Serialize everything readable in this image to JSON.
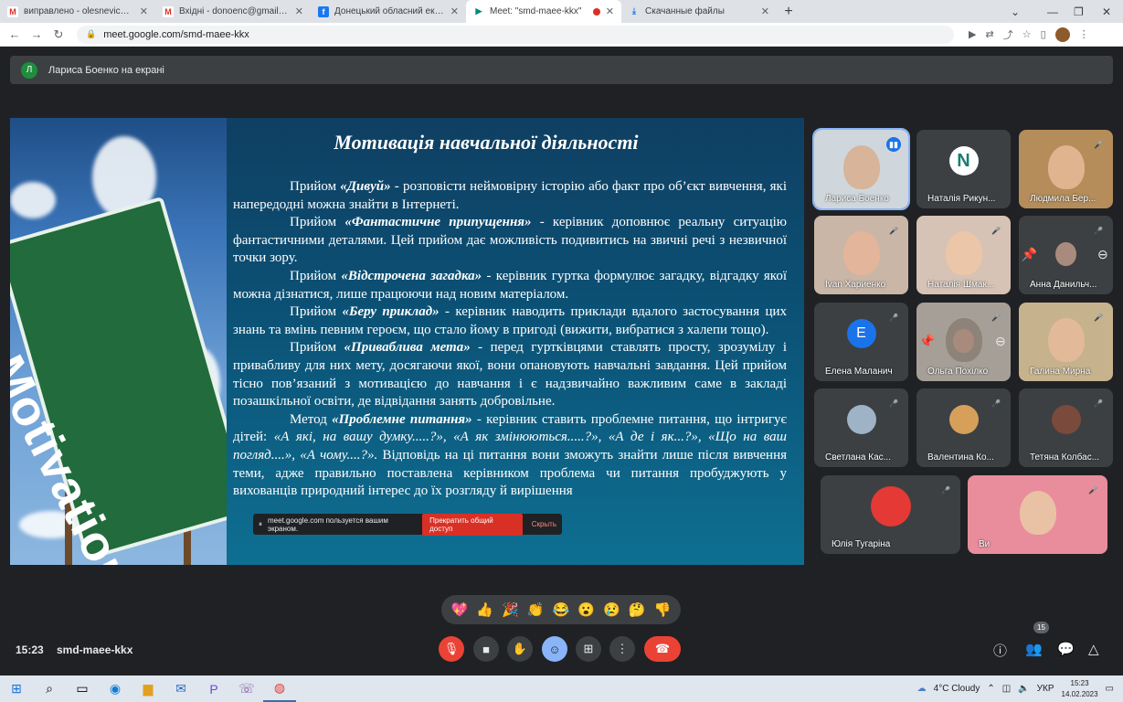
{
  "browser": {
    "tabs": [
      {
        "label": "виправлено - olesnevich88a@g",
        "icon": "gmail-icon"
      },
      {
        "label": "Вхідні - donoenc@gmail.com - G",
        "icon": "gmail-icon"
      },
      {
        "label": "Донецький обласний еколого-",
        "icon": "facebook-icon"
      },
      {
        "label": "Meet: \"smd-maee-kkx\"",
        "icon": "meet-icon",
        "active": true
      },
      {
        "label": "Скачанные файлы",
        "icon": "download-icon"
      }
    ],
    "url": "meet.google.com/smd-maee-kkx"
  },
  "meet": {
    "presenting_banner": {
      "initial": "Л",
      "text": "Лариса Боенко на екрані"
    },
    "slide": {
      "title": "Мотивація навчальної діяльності",
      "sign_text": "Motivation",
      "paragraphs": [
        {
          "lead": "Прийом ",
          "term": "«Дивуй»",
          "rest": " - розповісти неймовірну історію або факт про об’єкт вивчення, які напередодні можна знайти в Інтернеті."
        },
        {
          "lead": "Прийом ",
          "term": "«Фантастичне припущення»",
          "rest": " - керівник доповнює реальну ситуацію фантастичними деталями. Цей прийом дає можливість подивитись на звичні речі з незвичної точки зору."
        },
        {
          "lead": "Прийом ",
          "term": "«Відстрочена загадка»",
          "rest": " - керівник гуртка формулює загадку, відгадку якої можна дізнатися, лише працюючи над новим матеріалом."
        },
        {
          "lead": "Прийом ",
          "term": "«Беру приклад»",
          "rest": " - керівник наводить приклади вдалого застосування цих знань та вмінь певним героєм, що стало йому в пригоді (вижити, вибратися з халепи тощо)."
        },
        {
          "lead": "Прийом ",
          "term": "«Приваблива мета»",
          "rest": " - перед гуртківцями ставлять просту, зрозумілу і привабливу для них мету, досягаючи якої, вони опановують навчальні завдання. Цей прийом тісно пов’язаний з мотивацією до навчання і є надзвичайно важливим саме в закладі позашкільної освіти, де відвідання занять добровільне."
        },
        {
          "lead": "Метод ",
          "term": "«Проблемне питання»",
          "rest": " - керівник ставить проблемне питання, що інтригує дітей: ",
          "quote": "«А які, на вашу думку.....?», «А як змінюються.....?», «А де і як...?», «Що на ваш погляд....», «А чому....?».",
          "tail": " Відповідь на ці питання вони зможуть знайти лише після вивчення теми, адже правильно поставлена керівником проблема чи питання пробуджують у вихованців природний інтерес до їх розгляду й вирішення"
        }
      ],
      "share_notice": {
        "text": "meet.google.com пользуется вашим экраном.",
        "stop": "Прекратить общий доступ",
        "hide": "Скрыть"
      }
    },
    "participants": [
      {
        "name": "Лариса Боенко",
        "muted": false,
        "speaking": true,
        "kind": "video",
        "bg": "#cfd7dc",
        "face": "#d8b49a"
      },
      {
        "name": "Наталія Рикун...",
        "muted": false,
        "kind": "avatar",
        "letter": "N",
        "avatar_bg": "#ffffff",
        "avatar_fg": "#1b7d6f"
      },
      {
        "name": "Людмила Бер...",
        "muted": true,
        "kind": "video",
        "bg": "#b58d5a",
        "face": "#e0b48f"
      },
      {
        "name": "Ivan Хариенко",
        "muted": true,
        "kind": "video",
        "bg": "#c9b6a6",
        "face": "#e3b59a"
      },
      {
        "name": "Наталія Шмак...",
        "muted": true,
        "kind": "video",
        "bg": "#d7c3b5",
        "face": "#ebc6a8"
      },
      {
        "name": "Анна Данильч...",
        "muted": true,
        "kind": "pinned",
        "bg": "#3c4043"
      },
      {
        "name": "Елена Маланич",
        "muted": true,
        "kind": "avatar",
        "letter": "E",
        "avatar_bg": "#1a73e8",
        "avatar_fg": "#ffffff"
      },
      {
        "name": "Ольга Похілко",
        "muted": true,
        "kind": "pinned-video",
        "bg": "#a59f97"
      },
      {
        "name": "Галина Мирна",
        "muted": true,
        "kind": "video",
        "bg": "#c7b28e",
        "face": "#e2b999"
      },
      {
        "name": "Светлана Кас...",
        "muted": true,
        "kind": "photo",
        "avatar_bg": "#9fb3c6"
      },
      {
        "name": "Валентина Ко...",
        "muted": true,
        "kind": "photo",
        "avatar_bg": "#d6a05b"
      },
      {
        "name": "Тетяна Колбас...",
        "muted": true,
        "kind": "photo",
        "avatar_bg": "#7a4a3c"
      },
      {
        "name": "Юлія Тугаріна",
        "muted": true,
        "kind": "photo-big",
        "avatar_bg": "#e53935"
      },
      {
        "name": "Ви",
        "muted": true,
        "kind": "video",
        "bg": "#e98d9c",
        "face": "#e9c2a6"
      }
    ],
    "reactions": [
      "💖",
      "👍",
      "🎉",
      "👏",
      "😂",
      "😮",
      "😢",
      "🤔",
      "👎"
    ],
    "bottom": {
      "time": "15:23",
      "meeting_code": "smd-maee-kkx",
      "participant_count": "15"
    }
  },
  "taskbar": {
    "weather": "4°C  Cloudy",
    "language": "УКР",
    "time": "15:23",
    "date": "14.02.2023"
  }
}
